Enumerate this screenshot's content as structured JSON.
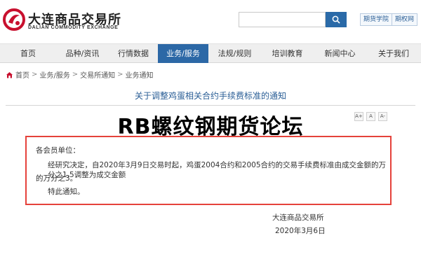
{
  "header": {
    "logo_cn": "大连商品交易所",
    "logo_en": "DALIAN COMMODITY EXCHANGE",
    "search_placeholder": "",
    "links": [
      "期货学院",
      "期权网"
    ]
  },
  "nav": {
    "items": [
      "首页",
      "品种/资讯",
      "行情数据",
      "业务/服务",
      "法规/规则",
      "培训教育",
      "新闻中心",
      "关于我们"
    ],
    "active": "业务/服务"
  },
  "breadcrumb": [
    "首页",
    "业务/服务",
    "交易所通知",
    "业务通知"
  ],
  "article": {
    "title": "关于调整鸡蛋相关合约手续费标准的通知",
    "font_buttons": [
      "A+",
      "A",
      "A-"
    ],
    "salutation": "各会员单位：",
    "body_line1": "经研究决定，自2020年3月9日交易时起，鸡蛋2004合约和2005合约的交易手续费标准由成交金额的万分之1.5调整为成交金额",
    "body_line2": "的万分之3。",
    "closing": "特此通知。",
    "signature_org": "大连商品交易所",
    "signature_date": "2020年3月6日"
  },
  "overlay_text": "RB螺纹钢期货论坛",
  "colors": {
    "brand_blue": "#2c68a6",
    "logo_red": "#c8102e",
    "highlight_border": "#e5423b",
    "title_blue": "#2a5e96"
  }
}
